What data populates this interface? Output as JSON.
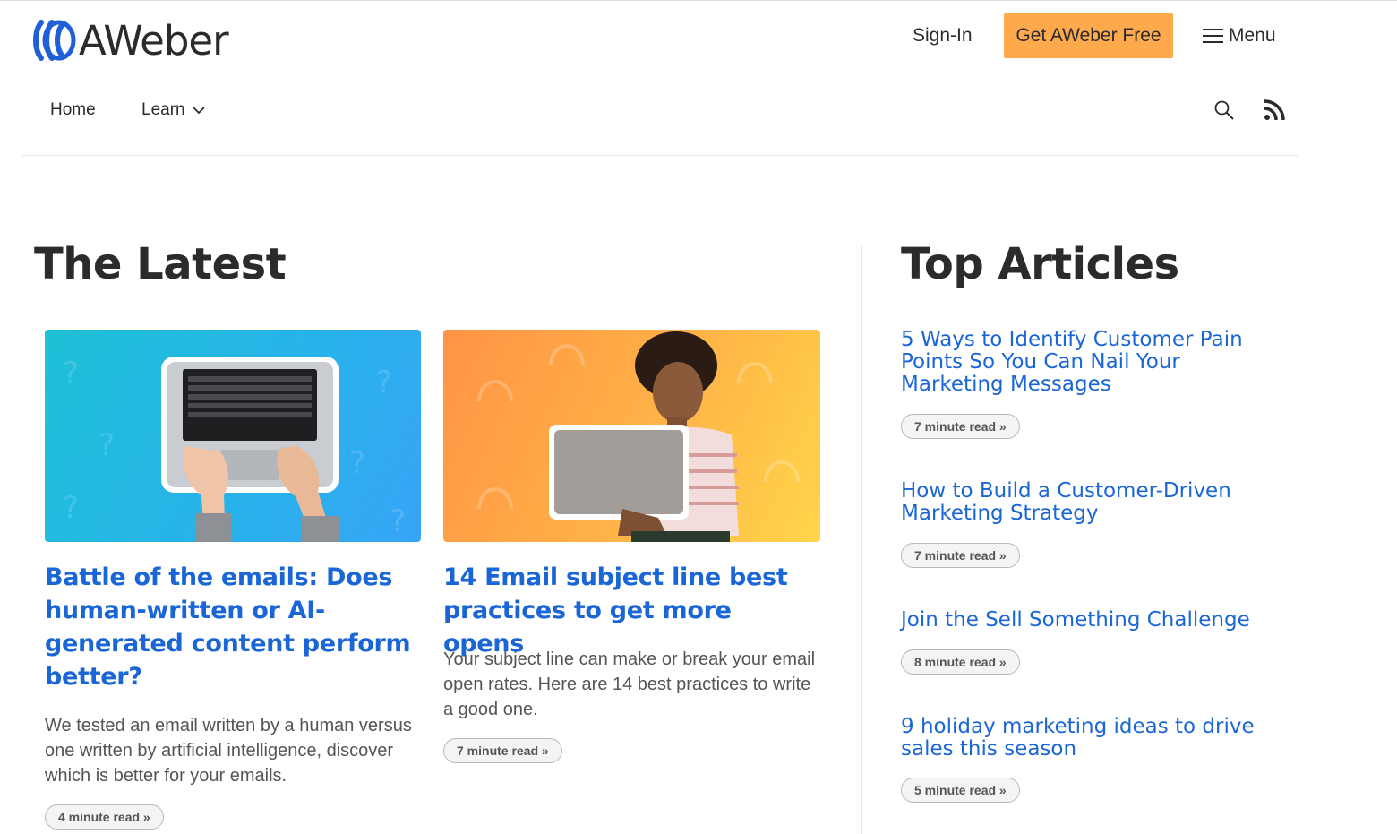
{
  "header": {
    "logo_text": "AWeber",
    "signin_label": "Sign-In",
    "cta_label": "Get AWeber Free",
    "menu_label": "Menu"
  },
  "nav": {
    "home_label": "Home",
    "learn_label": "Learn"
  },
  "latest": {
    "heading": "The Latest",
    "cards": [
      {
        "title": "Battle of the emails: Does human-written or AI-generated content perform better?",
        "excerpt": "We tested an email written by a human versus one written by artificial intelligence, discover which is better for your emails.",
        "read_time": "4 minute read »"
      },
      {
        "title": "14 Email subject line best practices to get more opens",
        "excerpt": "Your subject line can make or break your email open rates. Here are 14 best practices to write a good one.",
        "read_time": "7 minute read »"
      }
    ]
  },
  "top_articles": {
    "heading": "Top Articles",
    "items": [
      {
        "title": "5 Ways to Identify Customer Pain Points So You Can Nail Your Marketing Messages",
        "read_time": "7 minute read »"
      },
      {
        "title": "How to Build a Customer-Driven Marketing Strategy",
        "read_time": "7 minute read »"
      },
      {
        "title": "Join the Sell Something Challenge",
        "read_time": "8 minute read »"
      },
      {
        "title": "9 holiday marketing ideas to drive sales this season",
        "read_time": "5 minute read »"
      }
    ]
  },
  "colors": {
    "accent_blue": "#1a66d6",
    "cta_orange": "#ffa94d",
    "text_dark": "#2b2b2b"
  }
}
